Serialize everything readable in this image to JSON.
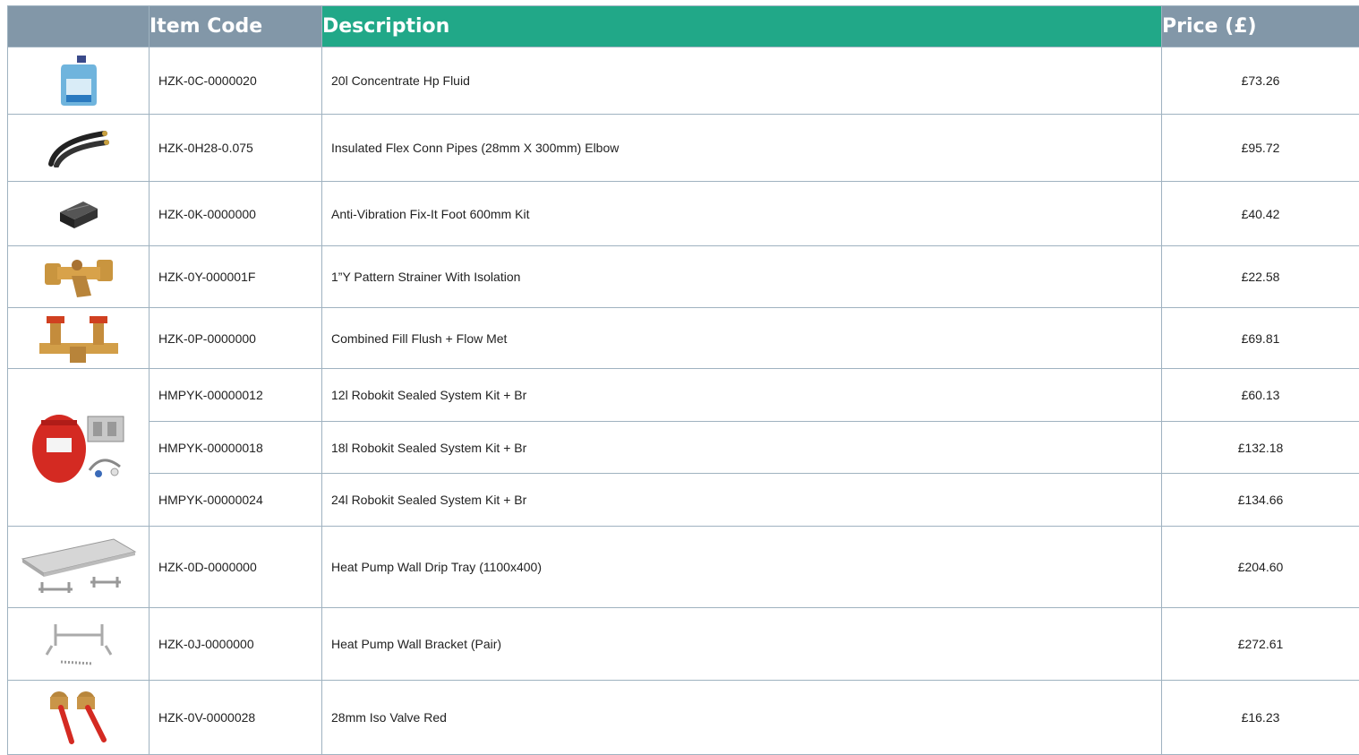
{
  "header": {
    "item_code": "Item Code",
    "description": "Description",
    "price": "Price (£)"
  },
  "rows": [
    {
      "code": "HZK-0C-0000020",
      "description": "20l Concentrate Hp Fluid",
      "price": "£73.26",
      "image_icon": "fluid-container-icon"
    },
    {
      "code": "HZK-0H28-0.075",
      "description": "Insulated Flex Conn Pipes (28mm X 300mm) Elbow",
      "price": "£95.72",
      "image_icon": "flex-pipes-icon"
    },
    {
      "code": "HZK-0K-0000000",
      "description": "Anti-Vibration Fix-It Foot 600mm Kit",
      "price": "£40.42",
      "image_icon": "rubber-foot-icon"
    },
    {
      "code": "HZK-0Y-000001F",
      "description": "1”Y Pattern Strainer With Isolation",
      "price": "£22.58",
      "image_icon": "strainer-icon"
    },
    {
      "code": "HZK-0P-0000000",
      "description": "Combined Fill Flush + Flow Met",
      "price": "£69.81",
      "image_icon": "fill-flush-valve-icon"
    },
    {
      "code": "HMPYK-00000012",
      "description": "12l Robokit Sealed System Kit + Br",
      "price": "£60.13",
      "image_icon": "expansion-vessel-icon"
    },
    {
      "code": "HMPYK-00000018",
      "description": "18l Robokit Sealed System Kit + Br",
      "price": "£132.18"
    },
    {
      "code": "HMPYK-00000024",
      "description": "24l Robokit Sealed System Kit + Br",
      "price": "£134.66"
    },
    {
      "code": "HZK-0D-0000000",
      "description": "Heat Pump Wall Drip Tray (1100x400)",
      "price": "£204.60",
      "image_icon": "drip-tray-icon"
    },
    {
      "code": "HZK-0J-0000000",
      "description": "Heat Pump Wall Bracket (Pair)",
      "price": "£272.61",
      "image_icon": "wall-bracket-icon"
    },
    {
      "code": "HZK-0V-0000028",
      "description": "28mm Iso Valve Red",
      "price": "£16.23",
      "image_icon": "iso-valve-icon"
    }
  ]
}
